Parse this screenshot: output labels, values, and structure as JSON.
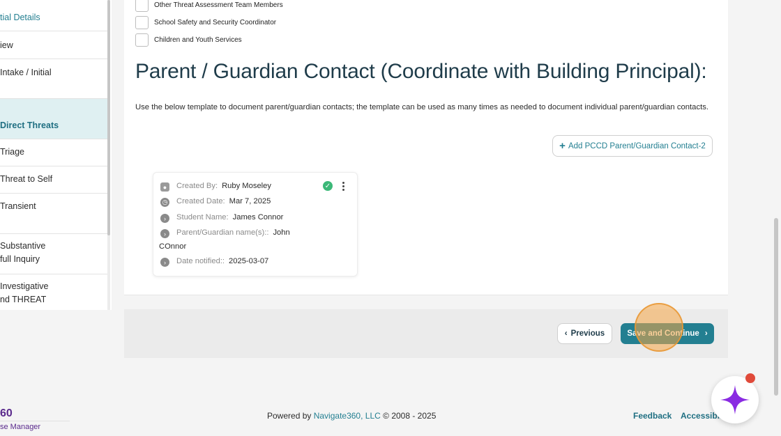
{
  "sidebar": {
    "items": [
      {
        "label": "tial Details"
      },
      {
        "label": "iew"
      },
      {
        "label": "Intake / Initial"
      },
      {
        "label": "Direct Threats"
      },
      {
        "label": "Triage"
      },
      {
        "label": "Threat to Self"
      },
      {
        "label": "Transient"
      },
      {
        "label_line1": "Substantive",
        "label_line2": "full Inquiry"
      },
      {
        "label_line1": "Investigative",
        "label_line2": "nd THREAT"
      }
    ]
  },
  "checkboxes": [
    {
      "label": "Other Threat Assessment Team Members",
      "checked": false
    },
    {
      "label": "School Safety and Security Coordinator",
      "checked": false
    },
    {
      "label": "Children and Youth Services",
      "checked": false
    }
  ],
  "section": {
    "title": "Parent / Guardian Contact (Coordinate with Building Principal):",
    "intro": "Use the below template to document parent/guardian contacts; the template can be used as many times as needed to document individual parent/guardian contacts.",
    "add_button_label": "Add PCCD Parent/Guardian Contact-2"
  },
  "contact_card": {
    "created_by_label": "Created By:",
    "created_by": "Ruby Moseley",
    "created_date_label": "Created Date:",
    "created_date": "Mar 7, 2025",
    "student_name_label": "Student Name:",
    "student_name": "James Connor",
    "guardian_label": "Parent/Guardian name(s)::",
    "guardian_first": "John",
    "guardian_rest": "COnnor",
    "date_notified_label": "Date notified::",
    "date_notified": "2025-03-07"
  },
  "nav": {
    "previous_label": "Previous",
    "save_label": "Save and Continue"
  },
  "footer": {
    "brand": "60",
    "brand_sub": "se Manager",
    "powered_prefix": "Powered by",
    "powered_link": "Navigate360, LLC",
    "powered_suffix": "© 2008 - 2025",
    "feedback": "Feedback",
    "accessibility": "Accessibili"
  },
  "colors": {
    "accent": "#237f91",
    "brand": "#5a2a8c",
    "success": "#3cb878",
    "notification": "#e04a3a",
    "ai_star": "#8a2be2"
  }
}
